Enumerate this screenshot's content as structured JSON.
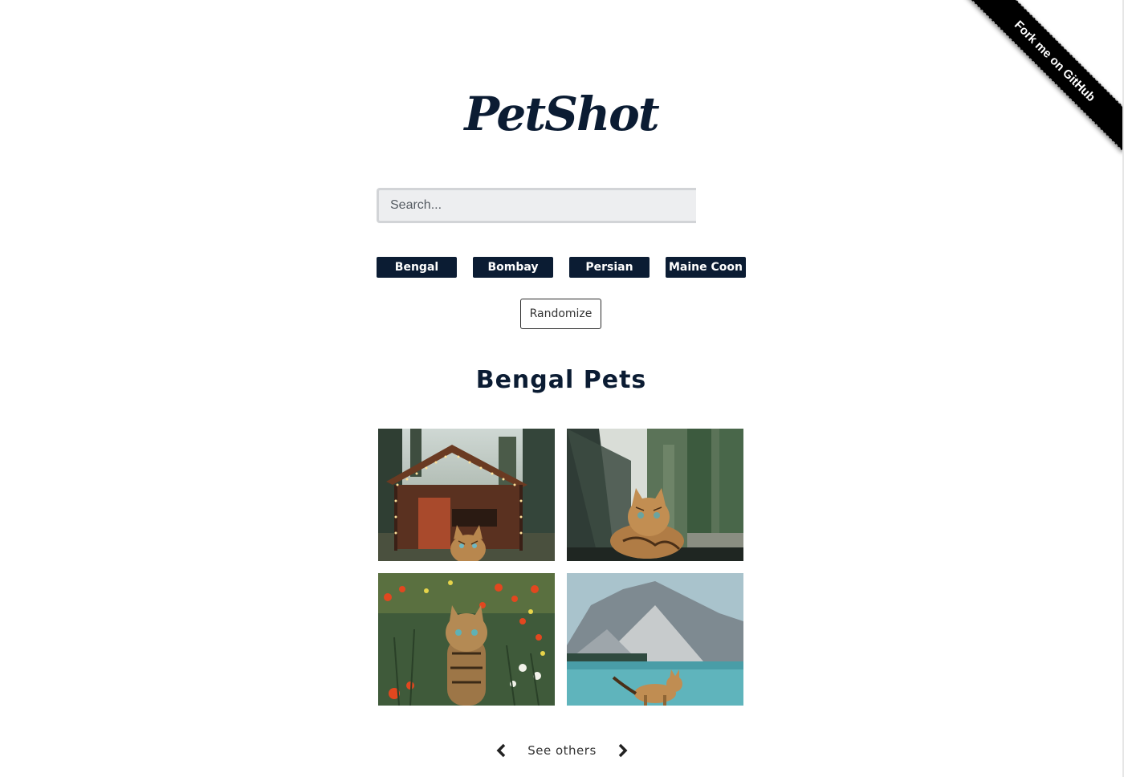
{
  "ribbon": {
    "label": "Fork me on GitHub"
  },
  "header": {
    "logo": "PetShot"
  },
  "search": {
    "placeholder": "Search..."
  },
  "breeds": [
    "Bengal",
    "Bombay",
    "Persian",
    "Maine Coon"
  ],
  "randomize_label": "Randomize",
  "gallery": {
    "title": "Bengal Pets",
    "photos": [
      {
        "subject": "bengal cat in front of a wooden cabin with string lights"
      },
      {
        "subject": "bengal cat looking out of a car window in a forest"
      },
      {
        "subject": "bengal cat in a meadow of red and white flowers"
      },
      {
        "subject": "bengal cat on a lakeshore with mountains behind"
      }
    ]
  },
  "pager": {
    "label": "See others",
    "prev_icon": "chevron-left-icon",
    "next_icon": "chevron-right-icon"
  },
  "colors": {
    "primary": "#0b1c33",
    "ribbon": "#000000",
    "search_bg": "#edeef0",
    "search_border": "#d2d4d7"
  }
}
